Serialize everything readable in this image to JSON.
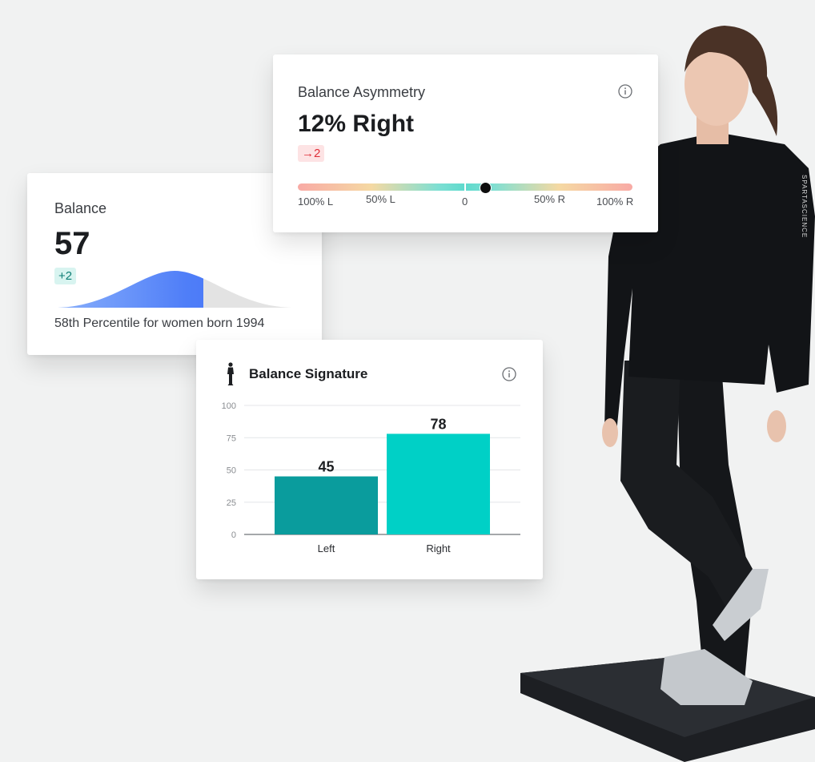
{
  "balance": {
    "title": "Balance",
    "score": "57",
    "change": "+2",
    "percentile_caption": "58th Percentile for women born 1994",
    "percentile": 58,
    "colors": {
      "fill": "#4f7ef8",
      "rest": "#e3e3e3",
      "badge_bg": "#d8f4f0",
      "badge_text": "#0d7d74"
    }
  },
  "asymmetry": {
    "title": "Balance Asymmetry",
    "value": "12% Right",
    "change": "→2",
    "scale_labels": [
      "100% L",
      "50% L",
      "0",
      "50% R",
      "100% R"
    ],
    "marker_value": 12,
    "colors": {
      "badge_bg": "#fde3e4",
      "badge_text": "#e0303a"
    },
    "icons": [
      "info-icon"
    ]
  },
  "signature": {
    "title": "Balance Signature",
    "icons": [
      "person-icon",
      "info-icon"
    ]
  },
  "chart_data": {
    "type": "bar",
    "categories": [
      "Left",
      "Right"
    ],
    "values": [
      45,
      78
    ],
    "title": "",
    "xlabel": "",
    "ylabel": "",
    "ylim": [
      0,
      100
    ],
    "yticks": [
      0,
      25,
      50,
      75,
      100
    ],
    "colors": [
      "#0a9c9d",
      "#00d0c6"
    ],
    "grid": true
  },
  "scene": {
    "shirt_text": "SPARTASCIENCE"
  }
}
